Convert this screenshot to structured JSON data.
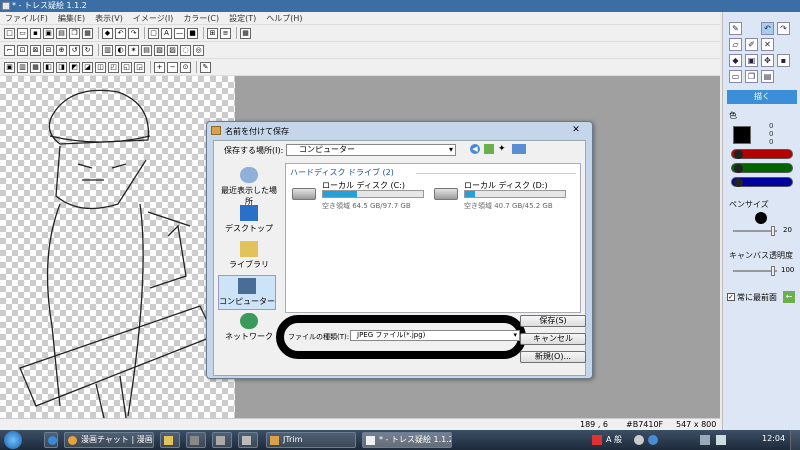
{
  "window": {
    "title": "* - トレス疑絵 1.1.2"
  },
  "menu": [
    "ファイル(F)",
    "編集(E)",
    "表示(V)",
    "イメージ(I)",
    "カラー(C)",
    "設定(T)",
    "ヘルプ(H)"
  ],
  "toolbar": {
    "row1": [
      "new-doc-icon",
      "open-icon",
      "save-icon",
      "save-as-icon",
      "print-icon",
      "copy-icon",
      "paste-icon",
      "undo-icon",
      "redo-icon"
    ],
    "row2": [
      "tool-a",
      "tool-b",
      "tool-c",
      "tool-d",
      "tool-e",
      "tool-f"
    ],
    "row3": [
      "tool-g",
      "tool-h",
      "tool-i",
      "tool-j"
    ]
  },
  "statusbar": {
    "coords": "189 , 6",
    "color": "#B7410F",
    "size": "547 x 800"
  },
  "rightpanel": {
    "draw_label": "描く",
    "color_label": "色",
    "rgb": [
      "0",
      "0",
      "0"
    ],
    "pen_size_label": "ペンサイズ",
    "pen_size_value": "20",
    "canvas_scale_label": "キャンバス透明度",
    "canvas_scale_value": "100",
    "always_top_label": "常に最前面",
    "slider_colors": [
      "#b40000",
      "#006400",
      "#0000a0"
    ]
  },
  "dialog": {
    "title": "名前を付けて保存",
    "save_in_label": "保存する場所(I):",
    "location": "コンピューター",
    "nav": [
      "最近表示した場所",
      "デスクトップ",
      "ライブラリ",
      "コンピューター",
      "ネットワーク"
    ],
    "section": "ハードディスク ドライブ (2)",
    "drives": [
      {
        "name": "ローカル ディスク (C:)",
        "free": "空き領域 64.5 GB/97.7 GB",
        "used": 0.34
      },
      {
        "name": "ローカル ディスク (D:)",
        "free": "空き領域 40.7 GB/45.2 GB",
        "used": 0.1
      }
    ],
    "filetype_label": "ファイルの種類(T):",
    "filetype_value": "JPEG ファイル(*.jpg)",
    "buttons": {
      "save": "保存(S)",
      "cancel": "キャンセル",
      "new_folder": "新規(O)..."
    }
  },
  "taskbar": {
    "items": [
      "漫画チャット | 漫画...",
      "JTrim",
      "* - トレス疑絵 1.1.2"
    ],
    "tray": [
      "A 般",
      "12:04"
    ]
  }
}
